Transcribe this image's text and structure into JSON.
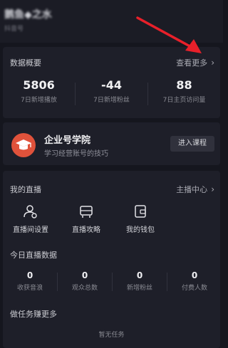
{
  "header": {
    "name": "鹅鱼◆之水",
    "sub": "抖音号"
  },
  "stats": {
    "title": "数据概要",
    "more": "查看更多",
    "items": [
      {
        "value": "5806",
        "label": "7日新增播放"
      },
      {
        "value": "-44",
        "label": "7日新增粉丝"
      },
      {
        "value": "88",
        "label": "7日主页访问量"
      }
    ]
  },
  "academy": {
    "title": "企业号学院",
    "subtitle": "学习经营账号的技巧",
    "button": "进入课程",
    "icon": "graduation-cap-icon",
    "accent": "#e0523b"
  },
  "live": {
    "title": "我的直播",
    "more": "主播中心",
    "tools": [
      {
        "label": "直播间设置",
        "icon": "user-settings-icon"
      },
      {
        "label": "直播攻略",
        "icon": "guide-icon"
      },
      {
        "label": "我的钱包",
        "icon": "wallet-icon"
      }
    ],
    "today_title": "今日直播数据",
    "today": [
      {
        "value": "0",
        "label": "收获音浪"
      },
      {
        "value": "0",
        "label": "观众总数"
      },
      {
        "value": "0",
        "label": "新增粉丝"
      },
      {
        "value": "0",
        "label": "付费人数"
      }
    ],
    "tasks_title": "做任务赚更多",
    "tasks_empty": "暂无任务"
  },
  "annotation": {
    "color": "#e8202a"
  }
}
